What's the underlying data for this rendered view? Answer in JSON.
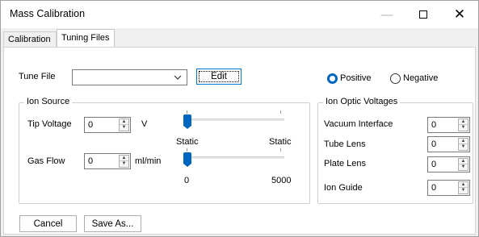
{
  "window": {
    "title": "Mass Calibration"
  },
  "tabs": [
    {
      "label": "Calibration"
    },
    {
      "label": "Tuning Files"
    }
  ],
  "tune_file": {
    "label": "Tune File",
    "value": "",
    "edit_label": "Edit"
  },
  "polarity": {
    "options": [
      {
        "label": "Positive",
        "selected": true
      },
      {
        "label": "Negative",
        "selected": false
      }
    ]
  },
  "ion_source": {
    "title": "Ion Source",
    "tip_voltage": {
      "label": "Tip Voltage",
      "value": "0",
      "unit": "V",
      "slider_min_label": "Static",
      "slider_max_label": "Static",
      "slider_value": 0
    },
    "gas_flow": {
      "label": "Gas Flow",
      "value": "0",
      "unit": "ml/min",
      "slider_min_label": "0",
      "slider_max_label": "5000",
      "slider_value": 0
    }
  },
  "ion_optics": {
    "title": "Ion Optic Voltages",
    "fields": [
      {
        "label": "Vacuum Interface",
        "value": "0"
      },
      {
        "label": "Tube Lens",
        "value": "0"
      },
      {
        "label": "Plate Lens",
        "value": "0"
      },
      {
        "label": "Ion Guide",
        "value": "0"
      }
    ]
  },
  "buttons": {
    "cancel": "Cancel",
    "save_as": "Save As..."
  },
  "colors": {
    "accent": "#0067c0",
    "focus": "#0078d7"
  }
}
